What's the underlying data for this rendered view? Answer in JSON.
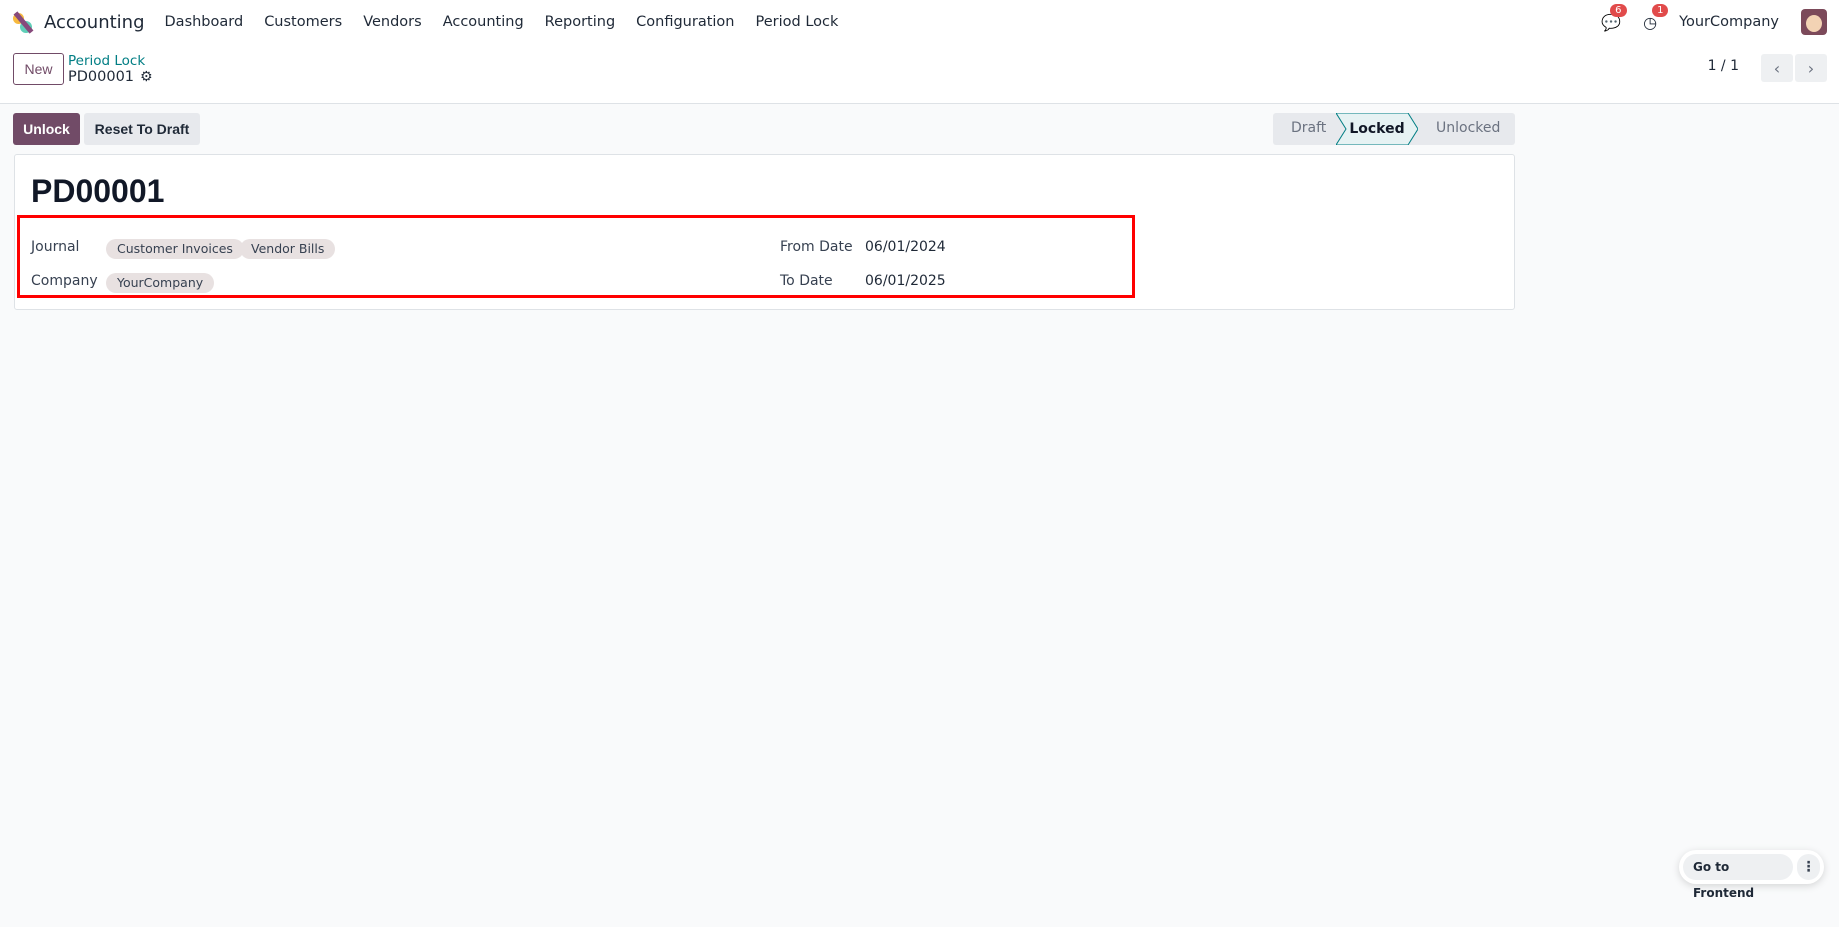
{
  "navbar": {
    "app_name": "Accounting",
    "menu": [
      "Dashboard",
      "Customers",
      "Vendors",
      "Accounting",
      "Reporting",
      "Configuration",
      "Period Lock"
    ],
    "messages_count": "6",
    "activities_count": "1",
    "company": "YourCompany"
  },
  "control_panel": {
    "new_label": "New",
    "breadcrumb_parent": "Period Lock",
    "breadcrumb_current": "PD00001",
    "pager": "1 / 1"
  },
  "actions": {
    "unlock": "Unlock",
    "reset": "Reset To Draft"
  },
  "statusbar": {
    "stages": [
      "Draft",
      "Locked",
      "Unlocked"
    ],
    "current": "Locked"
  },
  "form": {
    "title": "PD00001",
    "journal_label": "Journal",
    "journals": [
      "Customer Invoices",
      "Vendor Bills"
    ],
    "company_label": "Company",
    "company": "YourCompany",
    "from_label": "From Date",
    "from_date": "06/01/2024",
    "to_label": "To Date",
    "to_date": "06/01/2025"
  },
  "frontend": {
    "label": "Go to Frontend"
  },
  "colors": {
    "brand": "#714b67",
    "highlight": "#ff0000"
  }
}
